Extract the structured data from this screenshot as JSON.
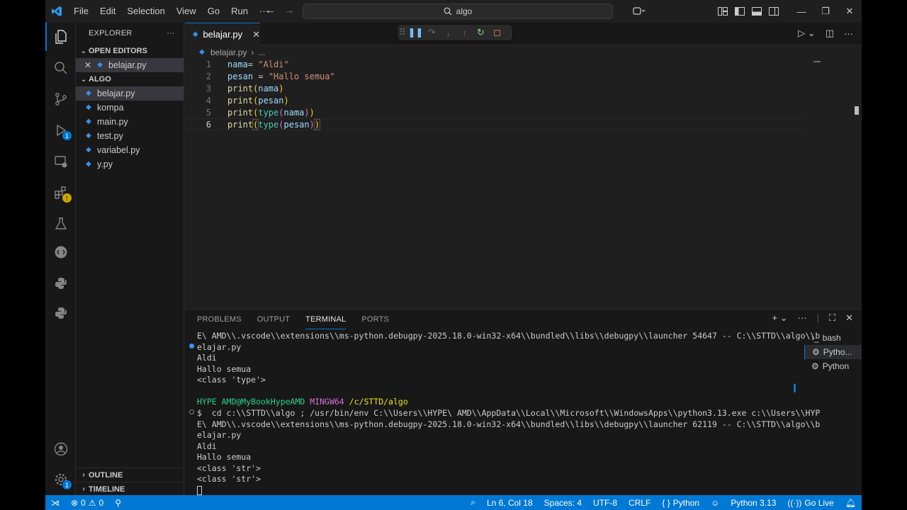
{
  "titlebar": {
    "menu": [
      "File",
      "Edit",
      "Selection",
      "View",
      "Go",
      "Run",
      "···"
    ],
    "search": "algo"
  },
  "activity_badges": {
    "run_debug": "1",
    "extensions": "!"
  },
  "sidebar": {
    "header": "EXPLORER",
    "open_editors_label": "OPEN EDITORS",
    "open_editors": [
      "belajar.py"
    ],
    "folder_label": "ALGO",
    "files": [
      "belajar.py",
      "kompa",
      "main.py",
      "test.py",
      "variabel.py",
      "y.py"
    ],
    "outline_label": "OUTLINE",
    "timeline_label": "TIMELINE"
  },
  "editor": {
    "tab_label": "belajar.py",
    "breadcrumb_file": "belajar.py",
    "breadcrumb_more": "...",
    "line_numbers": [
      "1",
      "2",
      "3",
      "4",
      "5",
      "6"
    ],
    "lines": [
      "nama= \"Aldi\"",
      "pesan = \"Hallo semua\"",
      "print(nama)",
      "print(pesan)",
      "print(type(nama))",
      "print(type(pesan))"
    ]
  },
  "panel": {
    "tabs": [
      "PROBLEMS",
      "OUTPUT",
      "TERMINAL",
      "PORTS"
    ],
    "active_tab": "TERMINAL",
    "terminal_lines": [
      "E\\ AMD\\\\.vscode\\\\extensions\\\\ms-python.debugpy-2025.18.0-win32-x64\\\\bundled\\\\libs\\\\debugpy\\\\launcher 54647 -- C:\\\\STTD\\\\algo\\\\b",
      "elajar.py",
      "Aldi",
      "Hallo semua",
      "<class 'type'>",
      "",
      "",
      "$  cd c:\\\\STTD\\\\algo ; /usr/bin/env C:\\\\Users\\\\HYPE\\ AMD\\\\AppData\\\\Local\\\\Microsoft\\\\WindowsApps\\\\python3.13.exe c:\\\\Users\\\\HYP",
      "E\\ AMD\\\\.vscode\\\\extensions\\\\ms-python.debugpy-2025.18.0-win32-x64\\\\bundled\\\\libs\\\\debugpy\\\\launcher 62119 -- C:\\\\STTD\\\\algo\\\\b",
      "elajar.py",
      "Aldi",
      "Hallo semua",
      "<class 'str'>",
      "<class 'str'>"
    ],
    "prompt": {
      "user": "HYPE AMD@MyBookHypeAMD",
      "shell": "MINGW64",
      "path": "/c/STTD/algo"
    },
    "terminals": [
      "bash",
      "Pytho...",
      "Python"
    ]
  },
  "statusbar": {
    "errors": "0",
    "warnings": "0",
    "position": "Ln 6, Col 18",
    "spaces": "Spaces: 4",
    "encoding": "UTF-8",
    "eol": "CRLF",
    "language": "Python",
    "interpreter": "Python 3.13",
    "golive": "Go Live"
  },
  "colors": {
    "accent": "#0078d4",
    "python_icon": "#3b8eea",
    "string": "#ce9178",
    "variable": "#9cdcfe",
    "function": "#dcdcaa",
    "class": "#4ec9b0"
  }
}
